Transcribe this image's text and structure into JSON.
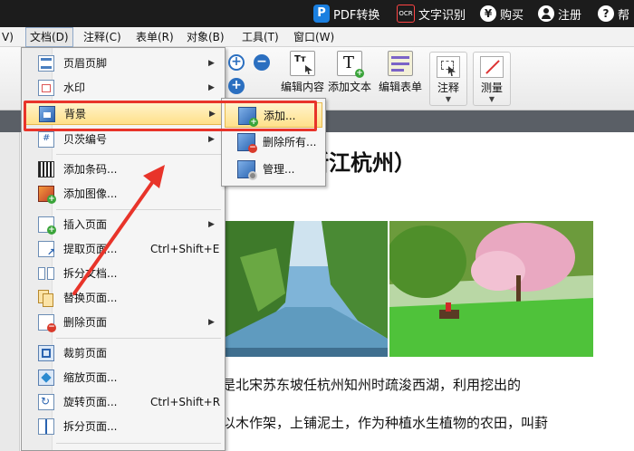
{
  "topbar": {
    "pdf_convert": "PDF转换",
    "ocr_badge": "OCR",
    "text_recognize": "文字识别",
    "buy_symbol": "¥",
    "buy": "购买",
    "register": "注册",
    "help_symbol": "?",
    "help": "帮"
  },
  "menubar": {
    "view_partial": "V)",
    "document": "文档(D)",
    "comment": "注释(C)",
    "form": "表单(R)",
    "object": "对象(B)",
    "tools": "工具(T)",
    "window": "窗口(W)"
  },
  "toolbar": {
    "edit_content": "编辑内容",
    "add_text": "添加文本",
    "edit_form": "编辑表单",
    "comment": "注释",
    "measure": "测量"
  },
  "document_menu": {
    "items": [
      {
        "label": "页眉页脚",
        "has_submenu": true
      },
      {
        "label": "水印",
        "has_submenu": true
      },
      {
        "label": "背景",
        "has_submenu": true
      },
      {
        "label": "贝茨编号",
        "has_submenu": true
      },
      {
        "label": "添加条码..."
      },
      {
        "label": "添加图像..."
      },
      {
        "label": "插入页面",
        "has_submenu": true
      },
      {
        "label": "提取页面...",
        "shortcut": "Ctrl+Shift+E"
      },
      {
        "label": "拆分文档..."
      },
      {
        "label": "替换页面..."
      },
      {
        "label": "删除页面",
        "has_submenu": true
      },
      {
        "label": "裁剪页面"
      },
      {
        "label": "缩放页面..."
      },
      {
        "label": "旋转页面...",
        "shortcut": "Ctrl+Shift+R"
      },
      {
        "label": "拆分页面..."
      }
    ],
    "submenu_arrow": "▶"
  },
  "background_submenu": {
    "items": [
      {
        "label": "添加..."
      },
      {
        "label": "删除所有..."
      },
      {
        "label": "管理..."
      }
    ]
  },
  "document_page": {
    "title_partial": "浙江杭州）",
    "line1": "是北宋苏东坡任杭州知州时疏浚西湖，利用挖出的",
    "line2": "以木作架，上铺泥土，作为种植水生植物的农田，叫葑"
  },
  "colors": {
    "highlight_box": "#e8342a",
    "arrow": "#e8342a",
    "topbar_bg": "#1c1c1c",
    "menu_highlight": "#ffe08a"
  }
}
